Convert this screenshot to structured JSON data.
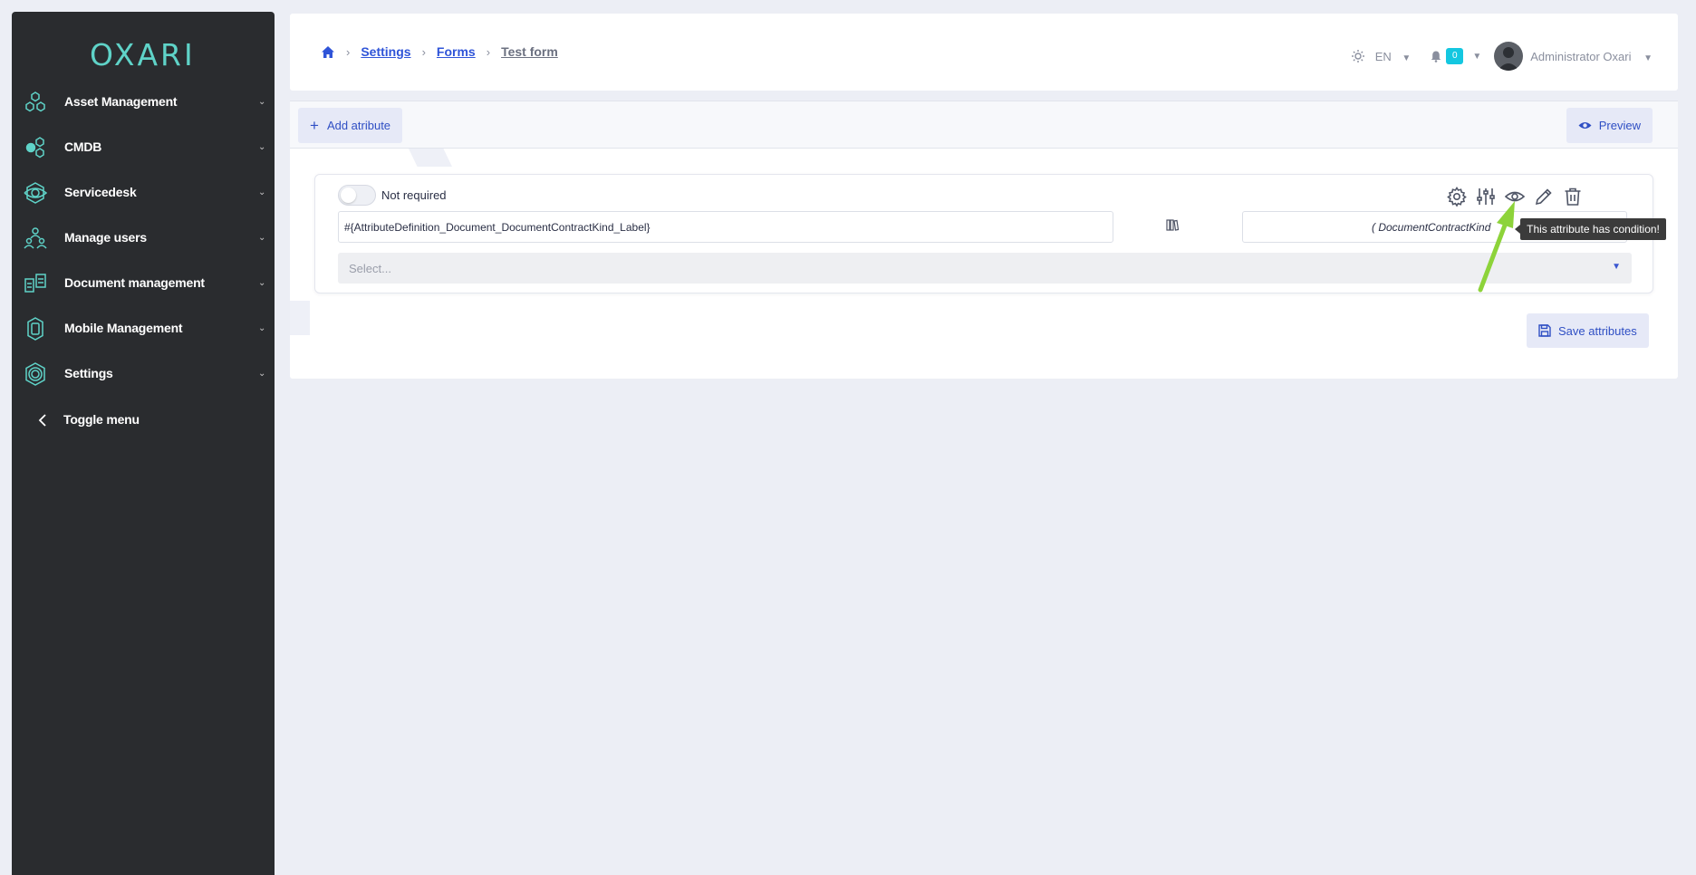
{
  "brand": {
    "logo_text": "OXARI",
    "accent": "#5fd3c8"
  },
  "sidebar": {
    "items": [
      {
        "label": "Asset Management",
        "icon": "hexagons-icon"
      },
      {
        "label": "CMDB",
        "icon": "nodes-icon"
      },
      {
        "label": "Servicedesk",
        "icon": "eye-gear-icon"
      },
      {
        "label": "Manage users",
        "icon": "users-icon"
      },
      {
        "label": "Document management",
        "icon": "documents-icon"
      },
      {
        "label": "Mobile Management",
        "icon": "mobile-icon"
      },
      {
        "label": "Settings",
        "icon": "gear-icon"
      }
    ],
    "toggle_label": "Toggle menu"
  },
  "breadcrumb": {
    "items": [
      "Settings",
      "Forms"
    ],
    "current": "Test form"
  },
  "header": {
    "language": "EN",
    "notification_count": "0",
    "user_name": "Administrator Oxari"
  },
  "toolbar": {
    "add_label": "Add atribute",
    "preview_label": "Preview"
  },
  "attribute": {
    "required_label": "Not required",
    "label_value": "#{AttributeDefinition_Document_DocumentContractKind_Label}",
    "code_value": "( DocumentContractKind",
    "select_placeholder": "Select..."
  },
  "tooltip": {
    "text": "This attribute has condition!"
  },
  "save_label": "Save attributes",
  "colors": {
    "primary": "#2f4fc4",
    "sidebar_bg": "#2a2c2f",
    "arrow": "#8dd33a",
    "badge": "#14c7e0"
  }
}
